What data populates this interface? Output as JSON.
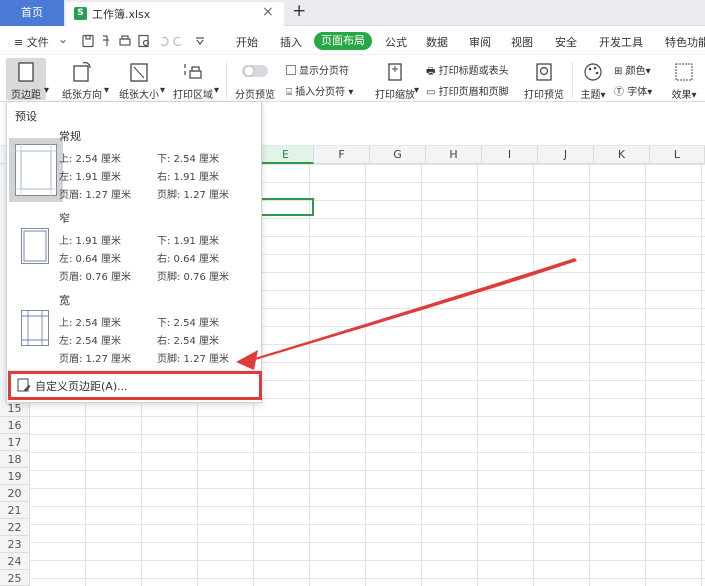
{
  "tabs": {
    "home": "首页",
    "doc_icon": "S",
    "doc_name": "工作簿.xlsx",
    "close": "×",
    "add": "+"
  },
  "menu": {
    "file": "≡ 文件",
    "items": [
      "开始",
      "插入",
      "页面布局",
      "公式",
      "数据",
      "审阅",
      "视图",
      "安全",
      "开发工具",
      "特色功能"
    ],
    "active": "页面布局"
  },
  "ribbon": {
    "margins": "页边距",
    "orientation": "纸张方向",
    "size": "纸张大小",
    "print_area": "打印区域",
    "page_break_preview": "分页预览",
    "show_page_breaks": "显示分页符",
    "insert_page_break": "插入分页符",
    "print_scale": "打印缩放",
    "print_titles": "打印标题或表头",
    "print_header_footer": "打印页眉和页脚",
    "print_preview": "打印预览",
    "theme": "主题",
    "colors": "颜色",
    "fonts": "字体",
    "effects": "效果"
  },
  "sheet": {
    "columns": [
      "E",
      "F",
      "G",
      "H",
      "I",
      "J",
      "K",
      "L"
    ],
    "selected_column": "E",
    "rows": [
      "15",
      "16",
      "17",
      "18",
      "19",
      "20",
      "21",
      "22",
      "23",
      "24",
      "25"
    ]
  },
  "dropdown": {
    "heading": "预设",
    "presets": [
      {
        "name": "常规",
        "top": "上: 2.54 厘米",
        "bottom": "下: 2.54 厘米",
        "left": "左: 1.91 厘米",
        "right": "右: 1.91 厘米",
        "header": "页眉: 1.27 厘米",
        "footer": "页脚: 1.27 厘米"
      },
      {
        "name": "窄",
        "top": "上: 1.91 厘米",
        "bottom": "下: 1.91 厘米",
        "left": "左: 0.64 厘米",
        "right": "右: 0.64 厘米",
        "header": "页眉: 0.76 厘米",
        "footer": "页脚: 0.76 厘米"
      },
      {
        "name": "宽",
        "top": "上: 2.54 厘米",
        "bottom": "下: 2.54 厘米",
        "left": "左: 2.54 厘米",
        "right": "右: 2.54 厘米",
        "header": "页眉: 1.27 厘米",
        "footer": "页脚: 1.27 厘米"
      }
    ],
    "selected_preset": "常规",
    "custom": "自定义页边距(A)..."
  },
  "colors": {
    "accent": "#28a745",
    "home_tab": "#4b7ad6",
    "annotation": "#e03b3b"
  }
}
